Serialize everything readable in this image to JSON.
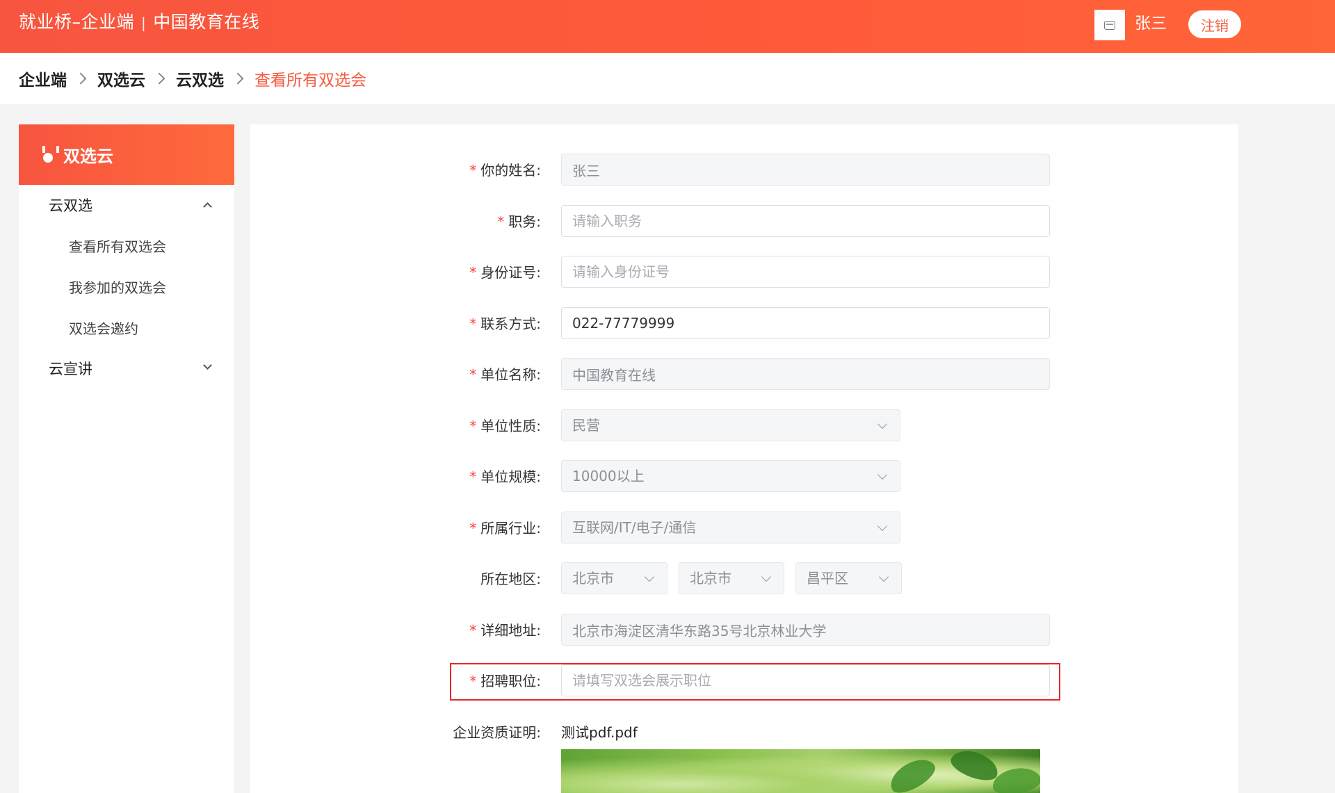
{
  "header": {
    "brand": "就业桥–企业端",
    "separator": "|",
    "org": "中国教育在线",
    "username": "张三",
    "logout_label": "注销"
  },
  "breadcrumb": [
    "企业端",
    "双选云",
    "云双选",
    "查看所有双选会"
  ],
  "sidebar": {
    "title": "双选云",
    "groups": [
      {
        "label": "云双选",
        "expanded": true,
        "items": [
          "查看所有双选会",
          "我参加的双选会",
          "双选会邀约"
        ]
      },
      {
        "label": "云宣讲",
        "expanded": false,
        "items": []
      }
    ]
  },
  "form": {
    "name": {
      "label": "你的姓名:",
      "value": "张三"
    },
    "position": {
      "label": "职务:",
      "placeholder": "请输入职务"
    },
    "id_number": {
      "label": "身份证号:",
      "placeholder": "请输入身份证号"
    },
    "contact": {
      "label": "联系方式:",
      "value": "022-77779999"
    },
    "company_name": {
      "label": "单位名称:",
      "value": "中国教育在线"
    },
    "company_type": {
      "label": "单位性质:",
      "value": "民营"
    },
    "company_size": {
      "label": "单位规模:",
      "value": "10000以上"
    },
    "industry": {
      "label": "所属行业:",
      "value": "互联网/IT/电子/通信"
    },
    "region": {
      "label": "所在地区:",
      "province": "北京市",
      "city": "北京市",
      "district": "昌平区"
    },
    "address": {
      "label": "详细地址:",
      "value": "北京市海淀区清华东路35号北京林业大学"
    },
    "recruit_position": {
      "label": "招聘职位:",
      "placeholder": "请填写双选会展示职位"
    },
    "certificate": {
      "label": "企业资质证明:",
      "filename": "测试pdf.pdf"
    },
    "required_mark": "*"
  },
  "colors": {
    "accent": "#f75a3f",
    "highlight": "#e8262c"
  }
}
